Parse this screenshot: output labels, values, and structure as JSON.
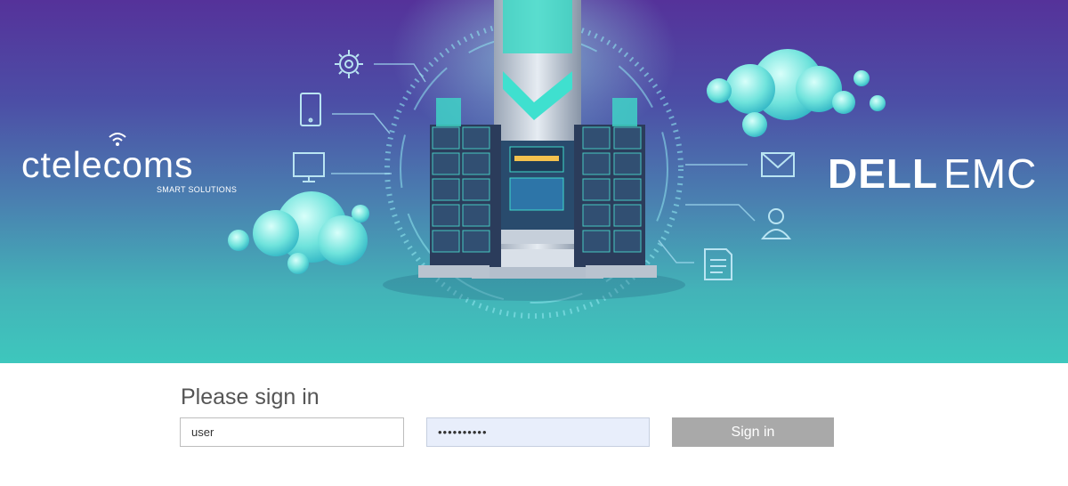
{
  "banner": {
    "left_logo": {
      "wordmark": "ctelecoms",
      "tagline": "SMART SOLUTIONS"
    },
    "right_logo": {
      "part1": "DELL",
      "part2": "EMC"
    },
    "icons": [
      "gear-icon",
      "tablet-icon",
      "monitor-icon",
      "mail-icon",
      "user-icon",
      "document-icon"
    ],
    "colors": {
      "top": "#55329a",
      "bottom": "#3ec7bd",
      "accent": "#5fe6d4"
    }
  },
  "signin": {
    "title": "Please sign in",
    "username_value": "user",
    "password_value": "••••••••••",
    "button_label": "Sign in"
  }
}
